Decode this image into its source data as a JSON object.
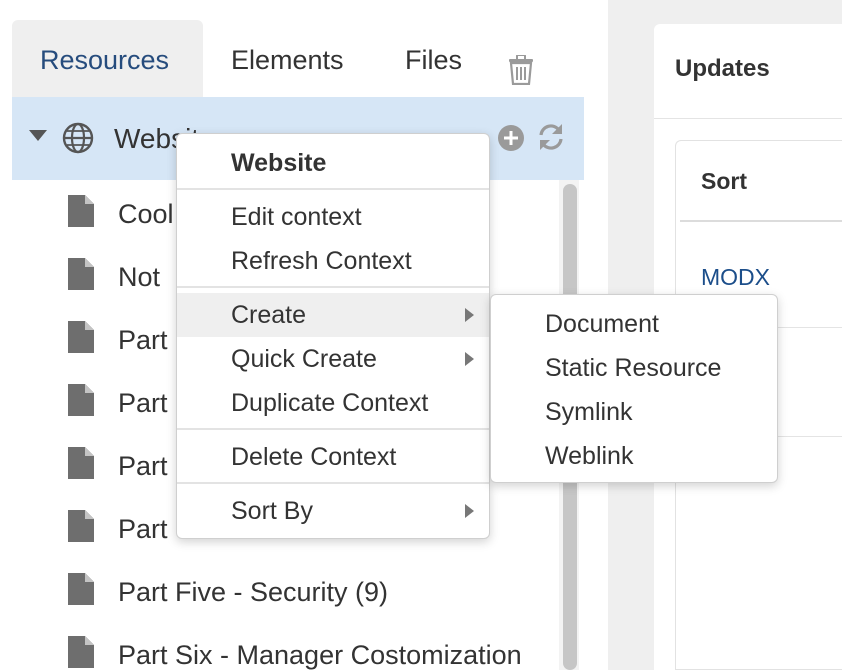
{
  "tabs": [
    {
      "label": "Resources",
      "active": true
    },
    {
      "label": "Elements",
      "active": false
    },
    {
      "label": "Files",
      "active": false
    }
  ],
  "icons": {
    "trash": "trash-icon",
    "caret": "caret-down-icon",
    "globe": "globe-icon",
    "add": "plus-circle-icon",
    "refresh": "refresh-icon",
    "document": "document-icon",
    "submenu_arrow": "chevron-right-icon"
  },
  "tree": {
    "root_label": "Website",
    "items": [
      {
        "label": "Cool"
      },
      {
        "label": "Not"
      },
      {
        "label": "Part"
      },
      {
        "label": "Part"
      },
      {
        "label": "Part"
      },
      {
        "label": "Part"
      },
      {
        "label": "Part Five - Security (9)"
      },
      {
        "label": "Part Six - Manager Costomization"
      }
    ]
  },
  "context_menu": {
    "header": "Website",
    "items": [
      {
        "label": "Edit context",
        "has_submenu": false
      },
      {
        "label": "Refresh Context",
        "has_submenu": false
      },
      {
        "label": "Create",
        "has_submenu": true,
        "highlighted": true
      },
      {
        "label": "Quick Create",
        "has_submenu": true
      },
      {
        "label": "Duplicate Context",
        "has_submenu": false
      },
      {
        "label": "Delete Context",
        "has_submenu": false
      },
      {
        "label": "Sort By",
        "has_submenu": true
      }
    ]
  },
  "create_submenu": {
    "items": [
      {
        "label": "Document"
      },
      {
        "label": "Static Resource"
      },
      {
        "label": "Symlink"
      },
      {
        "label": "Weblink"
      }
    ]
  },
  "dashboard": {
    "updates_title": "Updates",
    "sort_header": "Sort",
    "first_row_link": "MODX"
  },
  "colors": {
    "active_tab_text": "#264c7d",
    "tree_root_bg": "#d6e6f6",
    "menu_hover_bg": "#efefef",
    "link": "#1c4e8a",
    "panel_bg": "#efefef"
  }
}
